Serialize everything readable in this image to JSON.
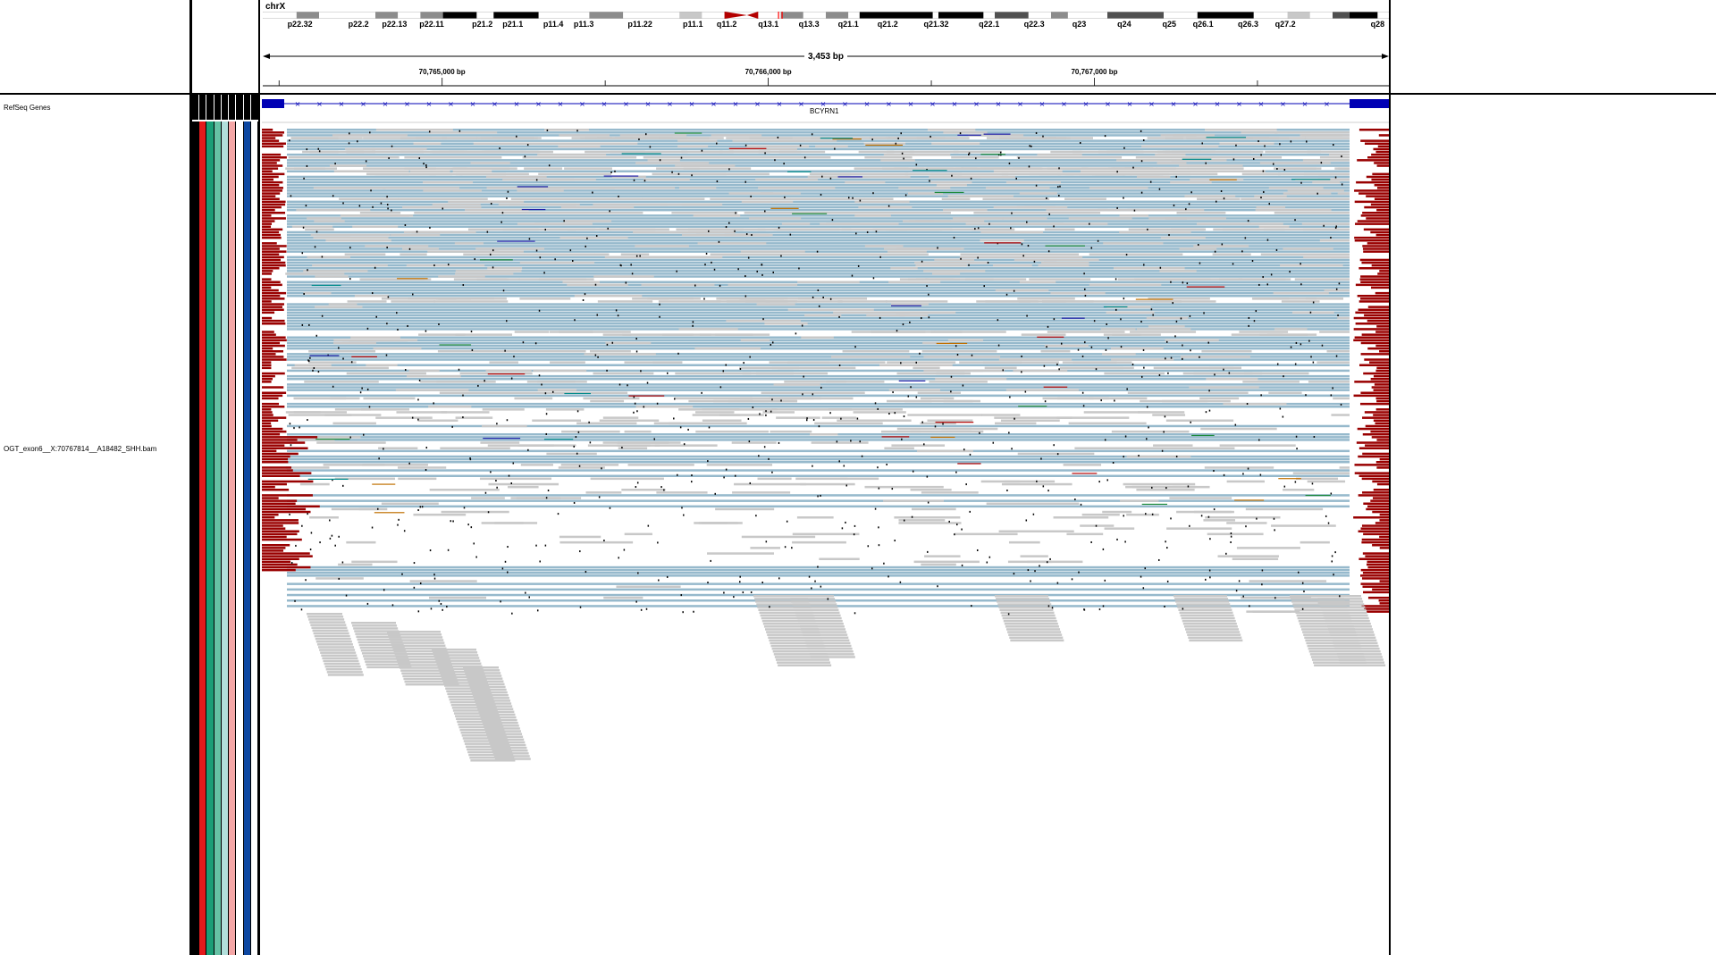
{
  "header": {
    "chromosome": "chrX",
    "span": "3,453 bp",
    "bands": [
      {
        "label": "p22.32",
        "start": 0.0,
        "end": 0.03,
        "stain": "white"
      },
      {
        "label": "",
        "start": 0.03,
        "end": 0.05,
        "stain": "gray"
      },
      {
        "label": "p22.2",
        "start": 0.05,
        "end": 0.1,
        "stain": "white"
      },
      {
        "label": "",
        "start": 0.1,
        "end": 0.12,
        "stain": "gray"
      },
      {
        "label": "p22.13",
        "start": 0.12,
        "end": 0.14,
        "stain": "white"
      },
      {
        "label": "",
        "start": 0.14,
        "end": 0.16,
        "stain": "gray"
      },
      {
        "label": "p22.11",
        "start": 0.16,
        "end": 0.16,
        "stain": "white"
      },
      {
        "label": "",
        "start": 0.16,
        "end": 0.19,
        "stain": "black"
      },
      {
        "label": "p21.2",
        "start": 0.19,
        "end": 0.205,
        "stain": "white"
      },
      {
        "label": "p21.1",
        "start": 0.205,
        "end": 0.245,
        "stain": "black"
      },
      {
        "label": "",
        "start": 0.245,
        "end": 0.27,
        "stain": "white"
      },
      {
        "label": "p11.4",
        "start": 0.27,
        "end": 0.29,
        "stain": "white"
      },
      {
        "label": "p11.3",
        "start": 0.29,
        "end": 0.32,
        "stain": "gray"
      },
      {
        "label": "",
        "start": 0.32,
        "end": 0.36,
        "stain": "white"
      },
      {
        "label": "p11.22",
        "start": 0.36,
        "end": 0.37,
        "stain": "white"
      },
      {
        "label": "",
        "start": 0.37,
        "end": 0.39,
        "stain": "lightgray"
      },
      {
        "label": "",
        "start": 0.39,
        "end": 0.41,
        "stain": "white"
      },
      {
        "label": "p11.1",
        "start": 0.41,
        "end": 0.43,
        "stain": "centromere-p"
      },
      {
        "label": "q11.2",
        "start": 0.43,
        "end": 0.44,
        "stain": "centromere-q"
      },
      {
        "label": "",
        "start": 0.44,
        "end": 0.46,
        "stain": "white"
      },
      {
        "label": "",
        "start": 0.46,
        "end": 0.48,
        "stain": "gray"
      },
      {
        "label": "q13.1",
        "start": 0.48,
        "end": 0.5,
        "stain": "white"
      },
      {
        "label": "",
        "start": 0.5,
        "end": 0.52,
        "stain": "gray"
      },
      {
        "label": "q13.3",
        "start": 0.52,
        "end": 0.53,
        "stain": "white"
      },
      {
        "label": "q21.1",
        "start": 0.53,
        "end": 0.595,
        "stain": "black"
      },
      {
        "label": "",
        "start": 0.595,
        "end": 0.6,
        "stain": "white"
      },
      {
        "label": "q21.2",
        "start": 0.6,
        "end": 0.59,
        "stain": "white"
      },
      {
        "label": "",
        "start": 0.6,
        "end": 0.64,
        "stain": "black"
      },
      {
        "label": "q21.32",
        "start": 0.64,
        "end": 0.65,
        "stain": "white"
      },
      {
        "label": "",
        "start": 0.65,
        "end": 0.68,
        "stain": "darkgray"
      },
      {
        "label": "q22.1",
        "start": 0.68,
        "end": 0.7,
        "stain": "white"
      },
      {
        "label": "",
        "start": 0.7,
        "end": 0.715,
        "stain": "gray"
      },
      {
        "label": "q22.3",
        "start": 0.715,
        "end": 0.75,
        "stain": "white"
      },
      {
        "label": "q23",
        "start": 0.75,
        "end": 0.8,
        "stain": "darkgray"
      },
      {
        "label": "",
        "start": 0.8,
        "end": 0.83,
        "stain": "white"
      },
      {
        "label": "q24",
        "start": 0.83,
        "end": 0.88,
        "stain": "black"
      },
      {
        "label": "q25",
        "start": 0.88,
        "end": 0.89,
        "stain": "white"
      },
      {
        "label": "q26.1",
        "start": 0.89,
        "end": 0.91,
        "stain": "white"
      },
      {
        "label": "",
        "start": 0.91,
        "end": 0.93,
        "stain": "lightgray"
      },
      {
        "label": "q26.3",
        "start": 0.93,
        "end": 0.95,
        "stain": "white"
      },
      {
        "label": "q27.2",
        "start": 0.95,
        "end": 0.965,
        "stain": "darkgray"
      },
      {
        "label": "",
        "start": 0.965,
        "end": 0.99,
        "stain": "black"
      },
      {
        "label": "q28",
        "start": 0.99,
        "end": 1.0,
        "stain": "white"
      }
    ],
    "band_label_positions": [
      {
        "label": "p22.32",
        "at": 0.033
      },
      {
        "label": "p22.2",
        "at": 0.085
      },
      {
        "label": "p22.13",
        "at": 0.117
      },
      {
        "label": "p22.11",
        "at": 0.15
      },
      {
        "label": "p21.2",
        "at": 0.195
      },
      {
        "label": "p21.1",
        "at": 0.222
      },
      {
        "label": "p11.4",
        "at": 0.258
      },
      {
        "label": "p11.3",
        "at": 0.285
      },
      {
        "label": "p11.22",
        "at": 0.335
      },
      {
        "label": "p11.1",
        "at": 0.382
      },
      {
        "label": "q11.2",
        "at": 0.412
      },
      {
        "label": "q13.1",
        "at": 0.449
      },
      {
        "label": "q13.3",
        "at": 0.485
      },
      {
        "label": "q21.1",
        "at": 0.52
      },
      {
        "label": "q21.2",
        "at": 0.555
      },
      {
        "label": "q21.32",
        "at": 0.598
      },
      {
        "label": "q22.1",
        "at": 0.645
      },
      {
        "label": "q22.3",
        "at": 0.685
      },
      {
        "label": "q23",
        "at": 0.725
      },
      {
        "label": "q24",
        "at": 0.765
      },
      {
        "label": "q25",
        "at": 0.805
      },
      {
        "label": "q26.1",
        "at": 0.835
      },
      {
        "label": "q26.3",
        "at": 0.875
      },
      {
        "label": "q27.2",
        "at": 0.908
      },
      {
        "label": "q28",
        "at": 0.99
      }
    ],
    "ticks": [
      {
        "label": "70,765,000 bp",
        "at": 70765000
      },
      {
        "label": "70,766,000 bp",
        "at": 70766000
      },
      {
        "label": "70,767,000 bp",
        "at": 70767000
      }
    ],
    "view_start": 70764450,
    "view_end": 70767903
  },
  "tracks": {
    "refseq_name": "RefSeq Genes",
    "bam_name": "OGT_exon6__X:70767814__A18482_SHH.bam",
    "gene_name": "BCYRN1"
  },
  "attribute_colors": [
    "#000000",
    "#e31a1c",
    "#1b9e77",
    "#66c2a5",
    "#b2dfdb",
    "#f4a6a6",
    "#ffffff",
    "#0d47a1",
    "#ffffff"
  ],
  "colors": {
    "read_gray": "#c8c8c8",
    "read_blue": "#96b9cc",
    "softclip_red": "#990000",
    "gene_blue": "#0000b4",
    "mismatch_black": "#000000"
  }
}
